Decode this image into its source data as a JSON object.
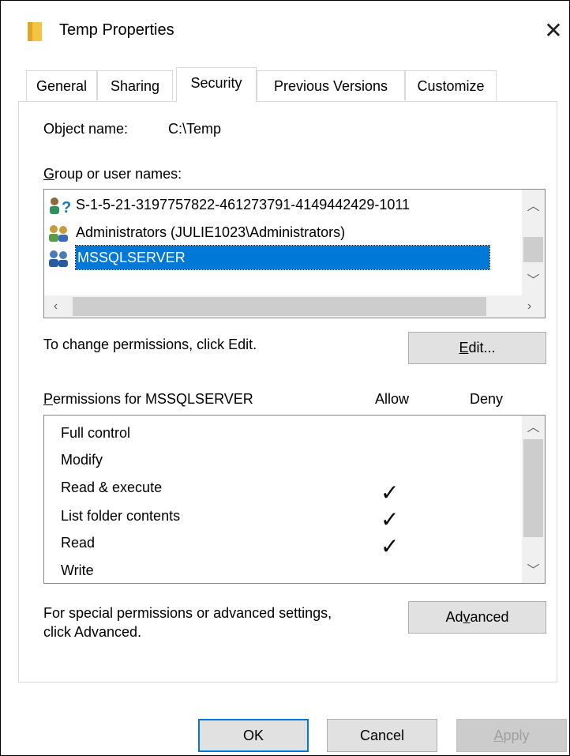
{
  "window": {
    "title": "Temp Properties",
    "close_glyph": "✕"
  },
  "tabs": [
    {
      "label": "General"
    },
    {
      "label": "Sharing"
    },
    {
      "label": "Security"
    },
    {
      "label": "Previous Versions"
    },
    {
      "label": "Customize"
    }
  ],
  "object": {
    "label": "Object name:",
    "value": "C:\\Temp"
  },
  "groups": {
    "label_prefix": "G",
    "label_rest": "roup or user names:",
    "items": [
      {
        "name": "S-1-5-21-3197757822-461273791-4149442429-1011",
        "icon": "unknown-user-icon"
      },
      {
        "name": "Administrators (JULIE1023\\Administrators)",
        "icon": "group-icon"
      },
      {
        "name": "MSSQLSERVER",
        "icon": "group-icon",
        "selected": true
      }
    ]
  },
  "change_hint": "To change permissions, click Edit.",
  "edit_button": {
    "prefix": "E",
    "rest": "dit..."
  },
  "permissions": {
    "title_prefix": "P",
    "title_rest": "ermissions for MSSQLSERVER",
    "allow_label": "Allow",
    "deny_label": "Deny",
    "rows": [
      {
        "name": "Full control",
        "allow": false,
        "deny": false
      },
      {
        "name": "Modify",
        "allow": false,
        "deny": false
      },
      {
        "name": "Read & execute",
        "allow": true,
        "deny": false
      },
      {
        "name": "List folder contents",
        "allow": true,
        "deny": false
      },
      {
        "name": "Read",
        "allow": true,
        "deny": false
      },
      {
        "name": "Write",
        "allow": false,
        "deny": false
      }
    ]
  },
  "advanced_hint_line1": "For special permissions or advanced settings,",
  "advanced_hint_line2": "click Advanced.",
  "advanced_button": {
    "prefix": "Ad",
    "underlined": "v",
    "rest": "anced"
  },
  "footer": {
    "ok": "OK",
    "cancel": "Cancel",
    "apply_prefix": "A",
    "apply_rest": "pply"
  },
  "colors": {
    "selection": "#0078d7",
    "default_border": "#0078d7"
  }
}
